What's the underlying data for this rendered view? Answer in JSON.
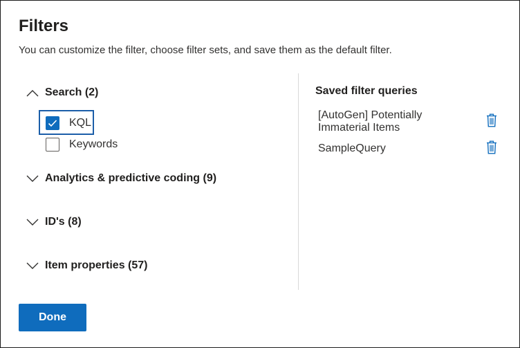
{
  "dialog": {
    "title": "Filters",
    "subtitle": "You can customize the filter, choose filter sets, and save them as the default filter."
  },
  "filter_groups": [
    {
      "label": "Search (2)",
      "expanded": true,
      "icon": "chevron-up-icon"
    },
    {
      "label": "Analytics & predictive coding (9)",
      "expanded": false,
      "icon": "chevron-down-icon"
    },
    {
      "label": "ID's (8)",
      "expanded": false,
      "icon": "chevron-down-icon"
    },
    {
      "label": "Item properties (57)",
      "expanded": false,
      "icon": "chevron-down-icon"
    }
  ],
  "search_options": [
    {
      "label": "KQL",
      "checked": true
    },
    {
      "label": "Keywords",
      "checked": false
    }
  ],
  "saved_queries": {
    "heading": "Saved filter queries",
    "items": [
      {
        "label": "[AutoGen] Potentially Immaterial Items",
        "icon": "trash-icon"
      },
      {
        "label": "SampleQuery",
        "icon": "trash-icon"
      }
    ]
  },
  "footer": {
    "done_label": "Done"
  },
  "colors": {
    "accent": "#0f6cbd",
    "focus": "#1b5ea8",
    "divider": "#d8d8d8",
    "text": "#201f1e"
  }
}
